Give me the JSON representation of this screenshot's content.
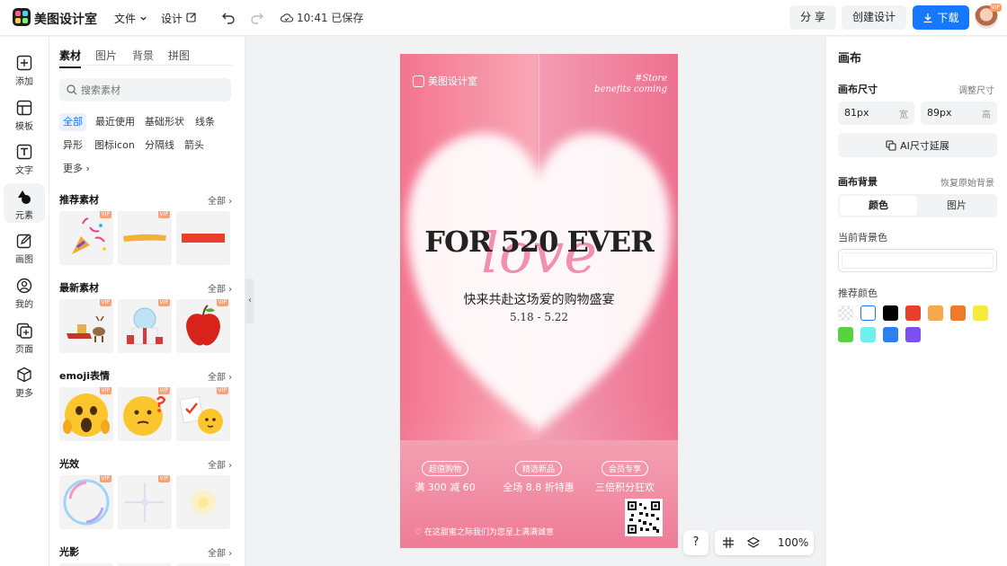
{
  "header": {
    "app_title": "美图设计室",
    "menu_file": "文件",
    "menu_design": "设计",
    "save_status": "10:41 已保存",
    "share_label": "分 享",
    "create_label": "创建设计",
    "download_label": "下载",
    "avatar_badge": "VIP"
  },
  "rail": [
    {
      "label": "添加",
      "icon": "plus-square-icon"
    },
    {
      "label": "模板",
      "icon": "template-icon"
    },
    {
      "label": "文字",
      "icon": "text-icon"
    },
    {
      "label": "元素",
      "icon": "shapes-icon"
    },
    {
      "label": "画图",
      "icon": "pencil-icon"
    },
    {
      "label": "我的",
      "icon": "user-icon"
    },
    {
      "label": "页面",
      "icon": "page-add-icon"
    },
    {
      "label": "更多",
      "icon": "cube-icon"
    }
  ],
  "panel": {
    "tabs": [
      "素材",
      "图片",
      "背景",
      "拼图"
    ],
    "search_placeholder": "搜索素材",
    "chips": [
      "全部",
      "最近使用",
      "基础形状",
      "线条",
      "异形",
      "图标icon",
      "分隔线",
      "箭头",
      "更多"
    ],
    "all_label": "全部",
    "vip": "VIP",
    "sections": [
      "推荐素材",
      "最新素材",
      "emoji表情",
      "光效",
      "光影"
    ]
  },
  "poster": {
    "brand": "美图设计室",
    "store_line1": "#Store",
    "store_line2": "benefits coming",
    "headline": "FOR 520 EVER",
    "script_word": "love",
    "subtitle": "快来共赴这场爱的购物盛宴",
    "date": "5.18 - 5.22",
    "features": [
      {
        "tag": "超值购物",
        "desc": "满 300 减 60"
      },
      {
        "tag": "精选新品",
        "desc": "全场 8.8 折特惠"
      },
      {
        "tag": "会员专享",
        "desc": "三倍积分狂欢"
      }
    ],
    "footer": "在这甜蜜之际我们为您呈上满满诚意"
  },
  "zoom": {
    "help": "?",
    "value": "100%"
  },
  "right_panel": {
    "title": "画布",
    "size_label": "画布尺寸",
    "size_adjust": "调整尺寸",
    "width_value": "81px",
    "width_unit": "宽",
    "height_value": "89px",
    "height_unit": "高",
    "ai_button": "AI尺寸延展",
    "bg_label": "画布背景",
    "bg_reset": "恢复原始背景",
    "seg_color": "颜色",
    "seg_image": "图片",
    "current_bg": "当前背景色",
    "recommend": "推荐颜色",
    "colors": [
      "transparent",
      "#ffffff",
      "#000000",
      "#e8402a",
      "#f4a94a",
      "#ee7a2a",
      "#f5e942",
      "#5ad13f",
      "#6ef0f0",
      "#2f7ff0",
      "#7b4ff0"
    ]
  }
}
